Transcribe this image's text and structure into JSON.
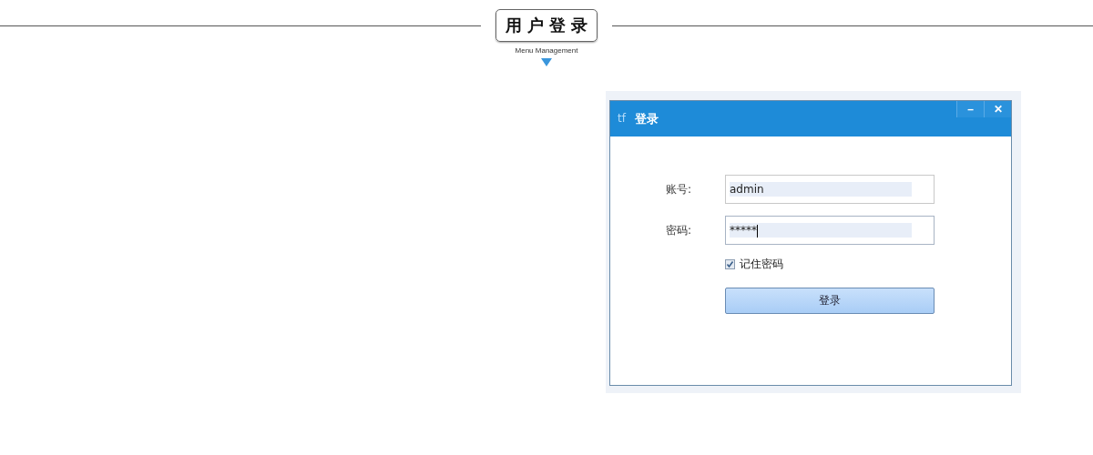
{
  "header": {
    "title": "用 户 登 录",
    "subtitle": "Menu Management"
  },
  "dialog": {
    "logo": "tf",
    "title": "登录",
    "controls": [
      "–",
      "✕"
    ],
    "fields": [
      {
        "label": "账号:",
        "value": "admin",
        "focused": false
      },
      {
        "label": "密码:",
        "value": "*****",
        "focused": true
      }
    ],
    "remember": {
      "label": "记住密码",
      "checked": true
    },
    "submit": "登录"
  }
}
